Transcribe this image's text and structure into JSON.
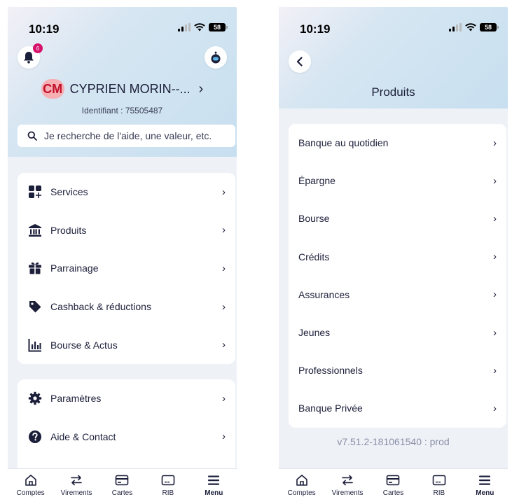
{
  "colors": {
    "brand": "#1c1f3a",
    "badge": "#d6106a",
    "avatar_bg": "#f6b0b4",
    "avatar_text": "#c0102a"
  },
  "left": {
    "status": {
      "time": "10:19",
      "battery": "58"
    },
    "notifications_count": "6",
    "profile": {
      "initials": "CM",
      "name": "CYPRIEN MORIN--...",
      "identifier": "Identifiant : 75505487"
    },
    "search": {
      "placeholder": "Je recherche de l'aide, une valeur, etc."
    },
    "menu_group_1": [
      {
        "label": "Services",
        "icon": "grid-plus-icon"
      },
      {
        "label": "Produits",
        "icon": "bank-icon"
      },
      {
        "label": "Parrainage",
        "icon": "gift-icon"
      },
      {
        "label": "Cashback & réductions",
        "icon": "tag-icon"
      },
      {
        "label": "Bourse & Actus",
        "icon": "chart-bars-icon"
      }
    ],
    "menu_group_2": [
      {
        "label": "Paramètres",
        "icon": "gear-icon"
      },
      {
        "label": "Aide & Contact",
        "icon": "help-icon"
      }
    ]
  },
  "right": {
    "status": {
      "time": "10:19",
      "battery": "58"
    },
    "title": "Produits",
    "items": [
      "Banque au quotidien",
      "Épargne",
      "Bourse",
      "Crédits",
      "Assurances",
      "Jeunes",
      "Professionnels",
      "Banque Privée"
    ],
    "version": "v7.51.2-181061540 : prod"
  },
  "tabbar": [
    {
      "label": "Comptes",
      "icon": "home-icon",
      "active": false
    },
    {
      "label": "Virements",
      "icon": "transfer-icon",
      "active": false
    },
    {
      "label": "Cartes",
      "icon": "card-icon",
      "active": false
    },
    {
      "label": "RIB",
      "icon": "rib-icon",
      "active": false
    },
    {
      "label": "Menu",
      "icon": "menu-icon",
      "active": true
    }
  ]
}
